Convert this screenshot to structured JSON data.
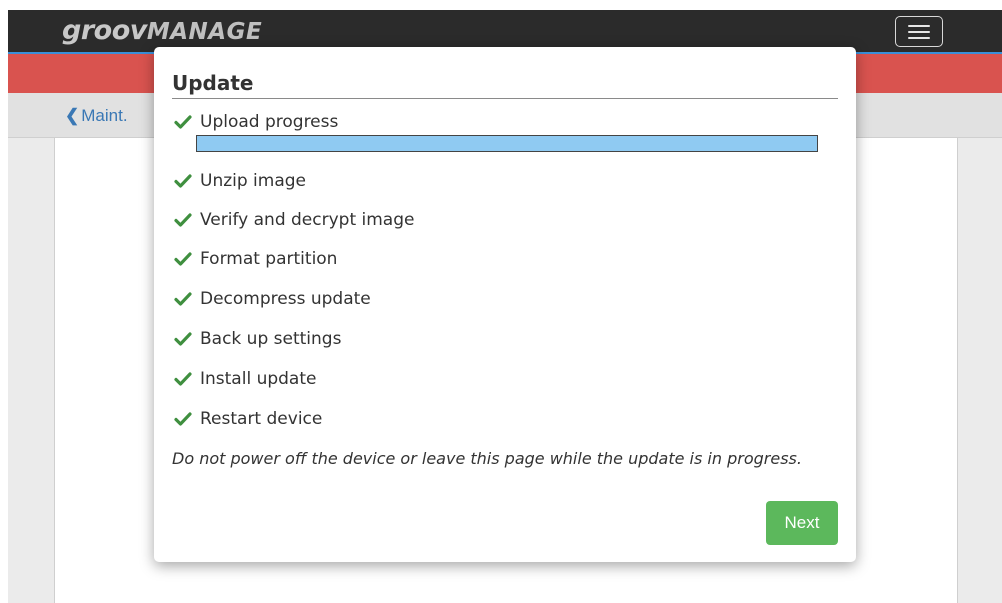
{
  "app": {
    "logo_brand": "groov",
    "logo_product": "MANAGE"
  },
  "breadcrumb": {
    "back_label": "Maint."
  },
  "modal": {
    "title": "Update",
    "upload_progress_fraction": 1.0,
    "steps": [
      {
        "label": "Upload progress",
        "icon": "check-icon",
        "status": "done"
      },
      {
        "label": "Unzip image",
        "icon": "check-icon",
        "status": "done"
      },
      {
        "label": "Verify and decrypt image",
        "icon": "check-icon",
        "status": "done"
      },
      {
        "label": "Format partition",
        "icon": "check-icon",
        "status": "done"
      },
      {
        "label": "Decompress update",
        "icon": "check-icon",
        "status": "done"
      },
      {
        "label": "Back up settings",
        "icon": "check-icon",
        "status": "done"
      },
      {
        "label": "Install update",
        "icon": "check-icon",
        "status": "done"
      },
      {
        "label": "Restart device",
        "icon": "check-icon",
        "status": "done"
      }
    ],
    "warning": "Do not power off the device or leave this page while the update is in progress.",
    "next_label": "Next"
  },
  "colors": {
    "navbar": "#2b2b2b",
    "alert_strip": "#d9534f",
    "check": "#3f8f3f",
    "progress_fill": "#8fcaf2",
    "next_button": "#5cb85c",
    "link": "#3a78b5"
  }
}
